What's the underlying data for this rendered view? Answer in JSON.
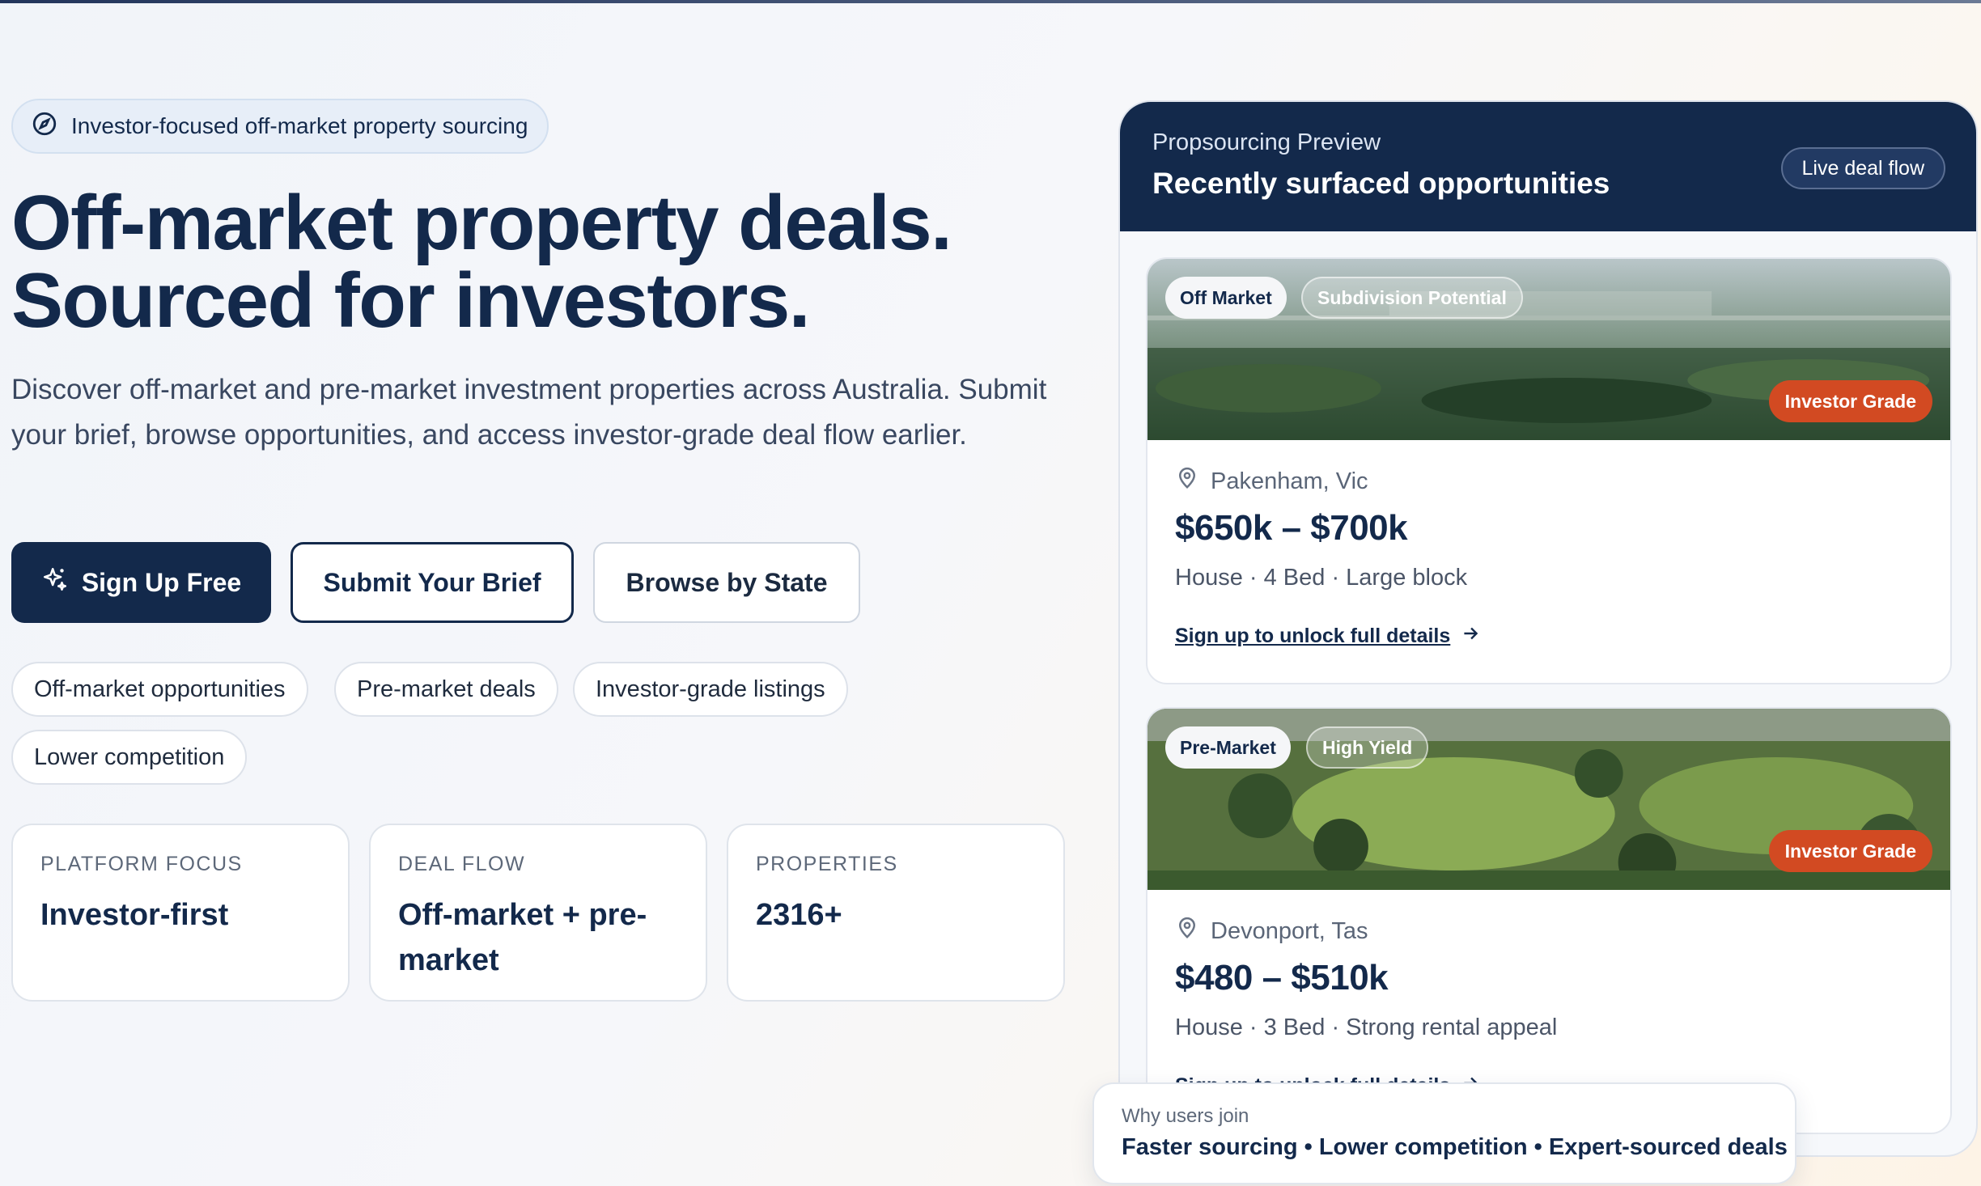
{
  "hero": {
    "eyebrow": "Investor-focused off-market property sourcing",
    "title_line1": "Off-market property deals.",
    "title_line2": "Sourced for investors.",
    "subtitle": "Discover off-market and pre-market investment properties across Australia. Submit your brief, browse opportunities, and access investor-grade deal flow earlier.",
    "buttons": {
      "sign_up": "Sign Up Free",
      "submit_brief": "Submit Your Brief",
      "browse_state": "Browse by State"
    },
    "tags": [
      "Off-market opportunities",
      "Pre-market deals",
      "Investor-grade listings",
      "Lower competition"
    ],
    "stats": [
      {
        "label": "PLATFORM FOCUS",
        "value": "Investor-first"
      },
      {
        "label": "DEAL FLOW",
        "value": "Off-market + pre-market"
      },
      {
        "label": "PROPERTIES",
        "value": "2316+"
      }
    ]
  },
  "preview": {
    "eyebrow": "Propsourcing Preview",
    "title": "Recently surfaced opportunities",
    "live_badge": "Live deal flow",
    "cards": [
      {
        "badge_primary": "Off Market",
        "badge_secondary": "Subdivision Potential",
        "grade": "Investor Grade",
        "location": "Pakenham, Vic",
        "price": "$650k – $700k",
        "meta": "House · 4 Bed · Large block",
        "cta": "Sign up to unlock full details"
      },
      {
        "badge_primary": "Pre-Market",
        "badge_secondary": "High Yield",
        "grade": "Investor Grade",
        "location": "Devonport, Tas",
        "price": "$480 – $510k",
        "meta": "House · 3 Bed · Strong rental appeal",
        "cta": "Sign up to unlock full details"
      }
    ]
  },
  "why": {
    "label": "Why users join",
    "text": "Faster sourcing • Lower competition • Expert-sourced deals"
  },
  "colors": {
    "navy": "#13294b",
    "grade_badge": "#d24a22",
    "eyebrow_bg": "#e7eef8"
  },
  "icons": [
    "compass-icon",
    "sparkle-icon",
    "location-pin-icon",
    "arrow-right-icon"
  ]
}
